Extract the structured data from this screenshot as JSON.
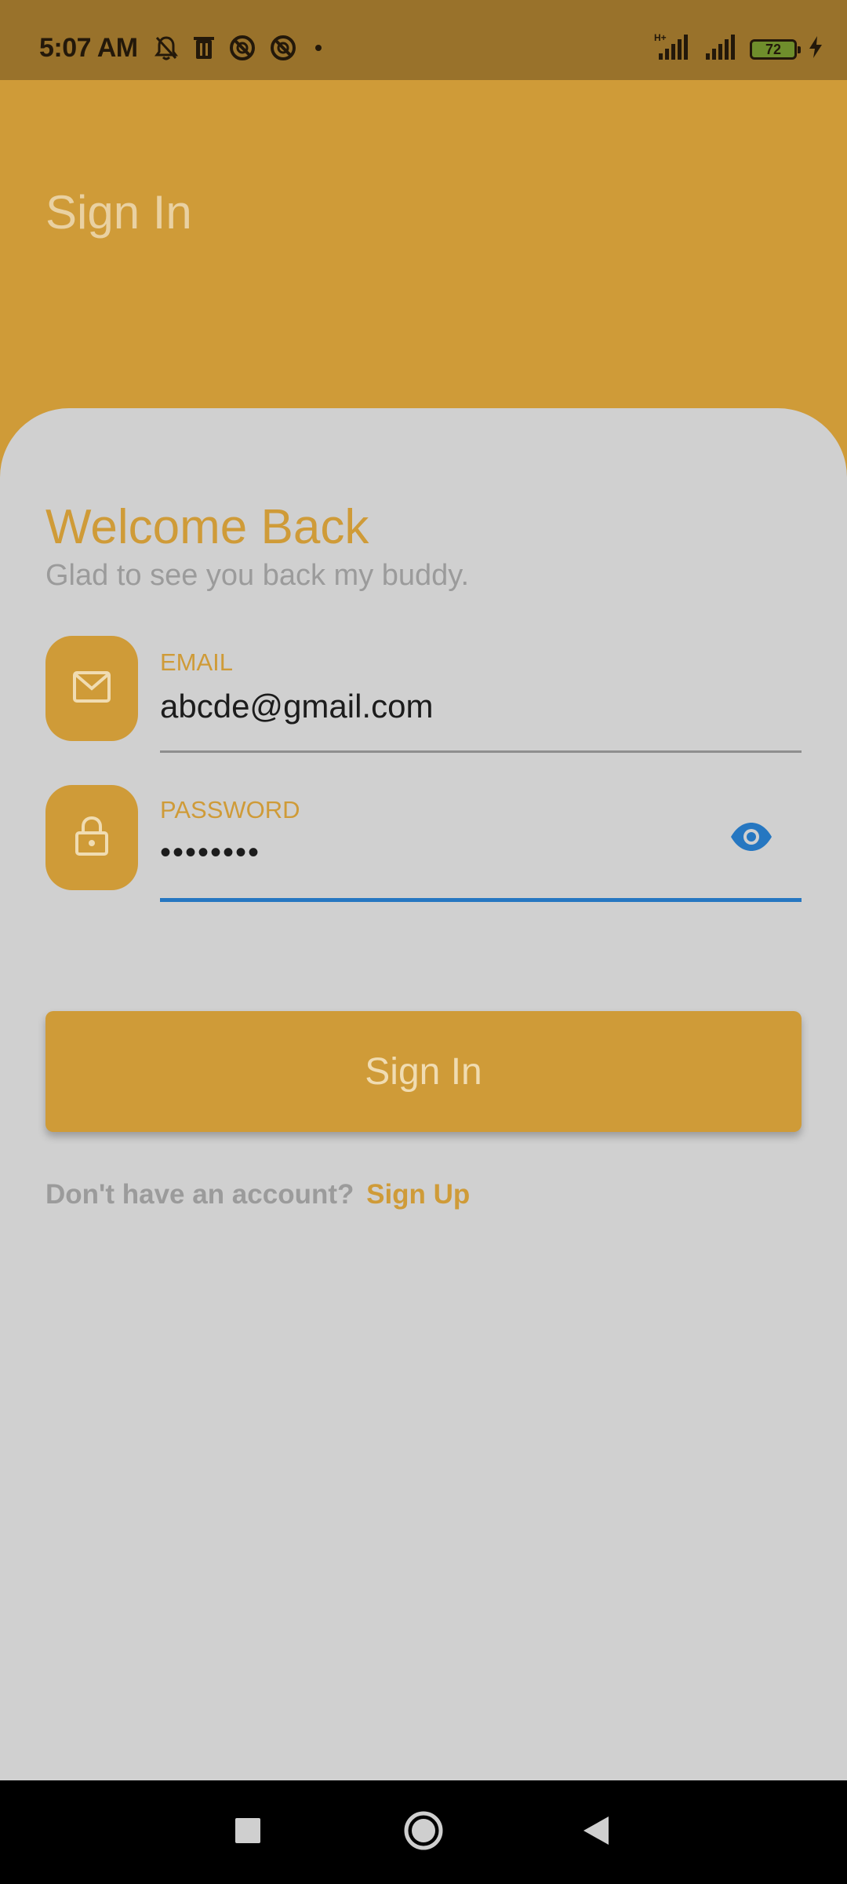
{
  "status_bar": {
    "time": "5:07 AM",
    "battery_level": "72",
    "network_label": "H+",
    "icons": [
      "bell-off-icon",
      "trash-icon",
      "blocked-icon",
      "blocked-icon",
      "dot-icon",
      "signal-icon",
      "signal-icon",
      "battery-icon",
      "charging-bolt-icon"
    ]
  },
  "header": {
    "title": "Sign In"
  },
  "card": {
    "welcome_title": "Welcome Back",
    "welcome_subtitle": "Glad to see you back my buddy."
  },
  "email_field": {
    "label": "EMAIL",
    "value": "abcde@gmail.com",
    "icon": "mail-icon"
  },
  "password_field": {
    "label": "PASSWORD",
    "value": "••••••••",
    "icon": "lock-icon",
    "toggle_icon": "eye-icon"
  },
  "signin_button": {
    "label": "Sign In"
  },
  "footer": {
    "prompt": "Don't have an account?",
    "link": "Sign Up"
  },
  "nav_bar": {
    "buttons": [
      "recents-square-icon",
      "home-circle-icon",
      "back-triangle-icon"
    ]
  },
  "colors": {
    "accent": "#cf9b38",
    "status_bar": "#99722b",
    "card_background": "#d0d0d0",
    "focus_underline": "#2677c1",
    "muted_text": "#9b9b9b"
  }
}
